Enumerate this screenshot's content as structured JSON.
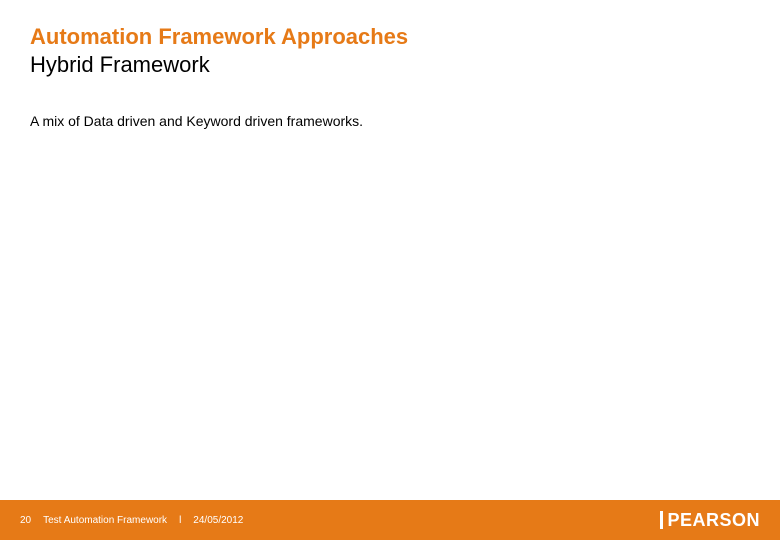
{
  "header": {
    "title": "Automation Framework Approaches",
    "subtitle": "Hybrid Framework"
  },
  "body": {
    "text": "A mix of Data driven and Keyword driven frameworks."
  },
  "footer": {
    "page_num": "20",
    "doc_title": "Test Automation Framework",
    "separator": "l",
    "date": "24/05/2012",
    "logo_text": "PEARSON"
  }
}
